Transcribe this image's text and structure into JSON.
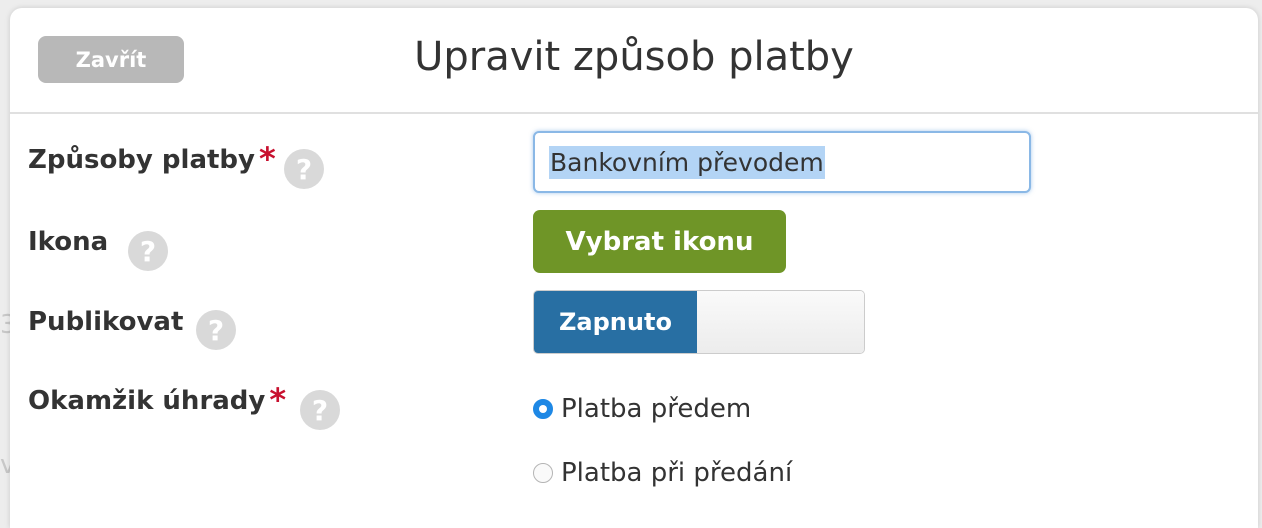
{
  "header": {
    "close_label": "Zavřít",
    "title": "Upravit způsob platby"
  },
  "form": {
    "payment_method": {
      "label": "Způsoby platby",
      "required_mark": "*",
      "value": "Bankovním převodem"
    },
    "icon": {
      "label": "Ikona",
      "button_label": "Vybrat ikonu"
    },
    "publish": {
      "label": "Publikovat",
      "toggle_on_label": "Zapnuto",
      "state": "on"
    },
    "payment_time": {
      "label": "Okamžik úhrady",
      "required_mark": "*",
      "options": [
        "Platba předem",
        "Platba při předání"
      ],
      "selected": "Platba předem"
    },
    "help_glyph": "?"
  },
  "colors": {
    "accent_blue": "#286fa3",
    "button_green": "#6f9527",
    "required_red": "#c8102e",
    "close_gray": "#b8b8b8"
  }
}
